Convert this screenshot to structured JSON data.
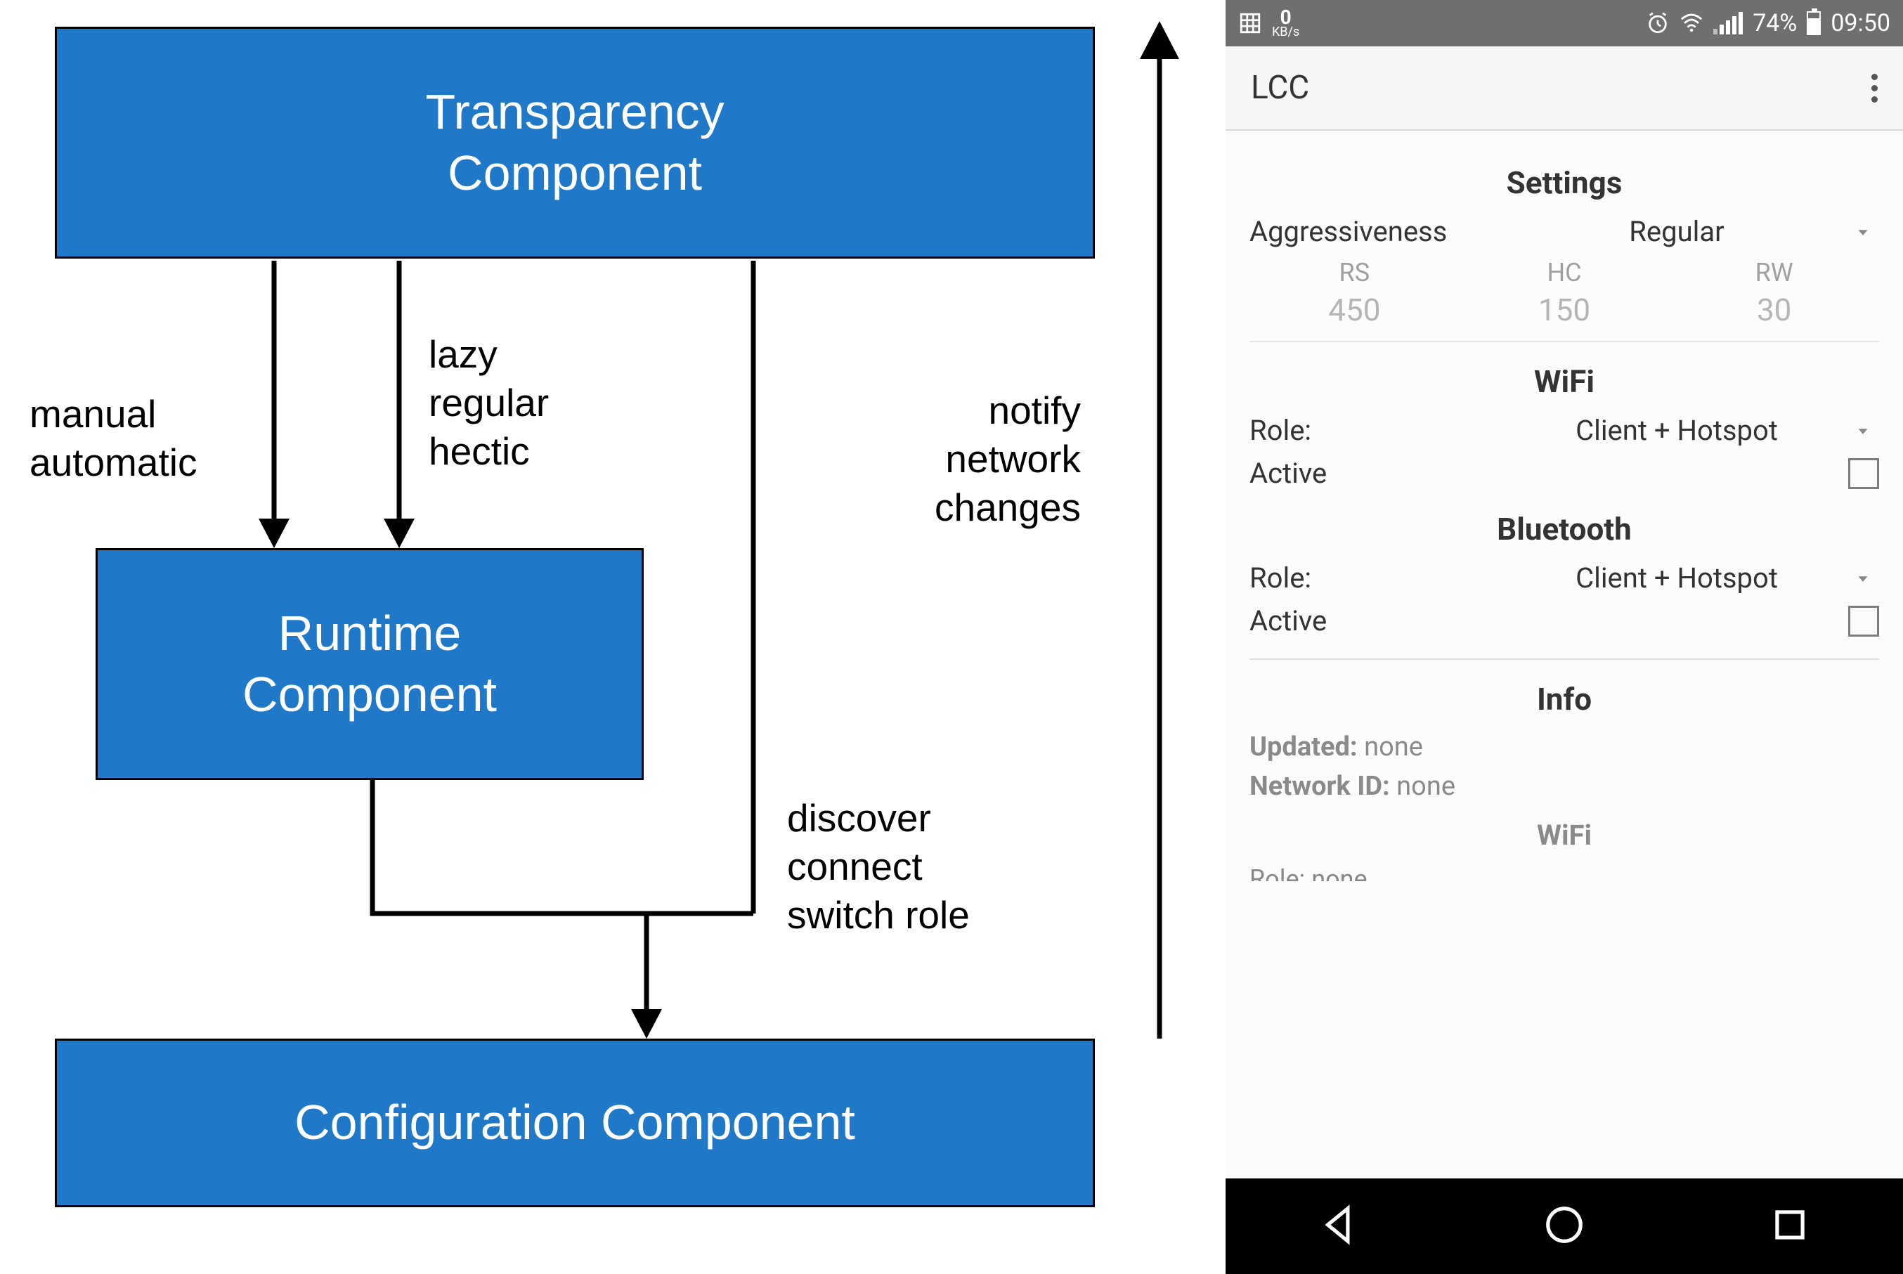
{
  "diagram": {
    "boxes": {
      "transparency": "Transparency\nComponent",
      "runtime": "Runtime\nComponent",
      "config": "Configuration Component"
    },
    "labels": {
      "manual": "manual\nautomatic",
      "lazy": "lazy\nregular\nhectic",
      "discover": "discover\nconnect\nswitch role",
      "notify": "notify\nnetwork\nchanges"
    }
  },
  "phone": {
    "statusbar": {
      "kb_value": "0",
      "kb_unit": "KB/s",
      "battery_pct": "74%",
      "clock": "09:50"
    },
    "appbar": {
      "title": "LCC"
    },
    "settings": {
      "title": "Settings",
      "aggressiveness_label": "Aggressiveness",
      "aggressiveness_value": "Regular",
      "columns": [
        {
          "head": "RS",
          "val": "450"
        },
        {
          "head": "HC",
          "val": "150"
        },
        {
          "head": "RW",
          "val": "30"
        }
      ],
      "wifi_title": "WiFi",
      "bt_title": "Bluetooth",
      "role_label": "Role:",
      "role_value": "Client + Hotspot",
      "active_label": "Active"
    },
    "info": {
      "title": "Info",
      "updated_label": "Updated:",
      "updated_value": "none",
      "network_label": "Network ID:",
      "network_value": "none",
      "wifi_subtitle": "WiFi",
      "cutoff": "Role: none"
    }
  }
}
